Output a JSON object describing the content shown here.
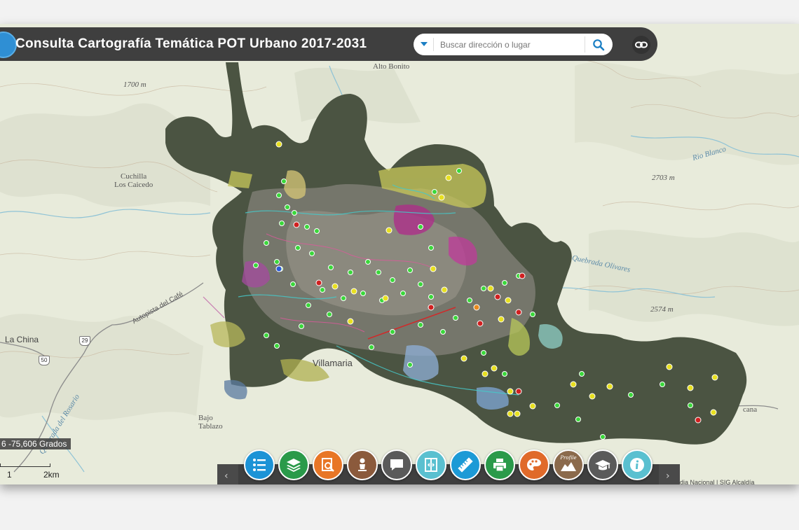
{
  "header": {
    "title": "Consulta Cartografía Temática POT Urbano 2017-2031",
    "search_placeholder": "Buscar dirección o lugar"
  },
  "map": {
    "labels": {
      "alto_bonito": "Alto\nBonito",
      "elev_1700": "1700 m",
      "cuchilla": "Cuchilla\nLos Caicedo",
      "elev_2703": "2703 m",
      "elev_2574": "2574 m",
      "rio_blanco": "Rio Blanco",
      "quebrada_olivares": "Quebrada Olivares",
      "autopista": "Autopista del Café",
      "la_china": "La China",
      "villamaria": "Villamaria",
      "bajo_tablazo": "Bajo\nTablazo",
      "quebrada_rosario": "Quebrada del Rosario",
      "cana": "cana",
      "route_29": "29",
      "route_50": "50"
    },
    "coordinates_readout": "6 -75,606 Grados",
    "scale": {
      "left": "1",
      "right": "2km"
    },
    "attribution": "idia Nacional | SIG   Alcaldía"
  },
  "toolbar": {
    "tools": [
      {
        "name": "legend",
        "color": "#1c93d6",
        "icon": "list-icon"
      },
      {
        "name": "layers",
        "color": "#2a9a4a",
        "icon": "layers-icon"
      },
      {
        "name": "query",
        "color": "#e87626",
        "icon": "search-document-icon"
      },
      {
        "name": "user",
        "color": "#8b5a3c",
        "icon": "person-icon"
      },
      {
        "name": "comments",
        "color": "#5a5a5a",
        "icon": "chat-icon"
      },
      {
        "name": "swipe",
        "color": "#5ac0d0",
        "icon": "swipe-icon"
      },
      {
        "name": "measure",
        "color": "#1c9ad6",
        "icon": "ruler-icon"
      },
      {
        "name": "print",
        "color": "#2a9a4a",
        "icon": "printer-icon"
      },
      {
        "name": "basemap",
        "color": "#e06a2a",
        "icon": "palette-icon"
      },
      {
        "name": "profile",
        "color": "#8b6a4c",
        "icon": "profile-icon",
        "label": "Profile"
      },
      {
        "name": "education",
        "color": "#5a5a5a",
        "icon": "graduation-cap-icon"
      },
      {
        "name": "about",
        "color": "#5ac0d0",
        "icon": "info-icon"
      }
    ]
  }
}
